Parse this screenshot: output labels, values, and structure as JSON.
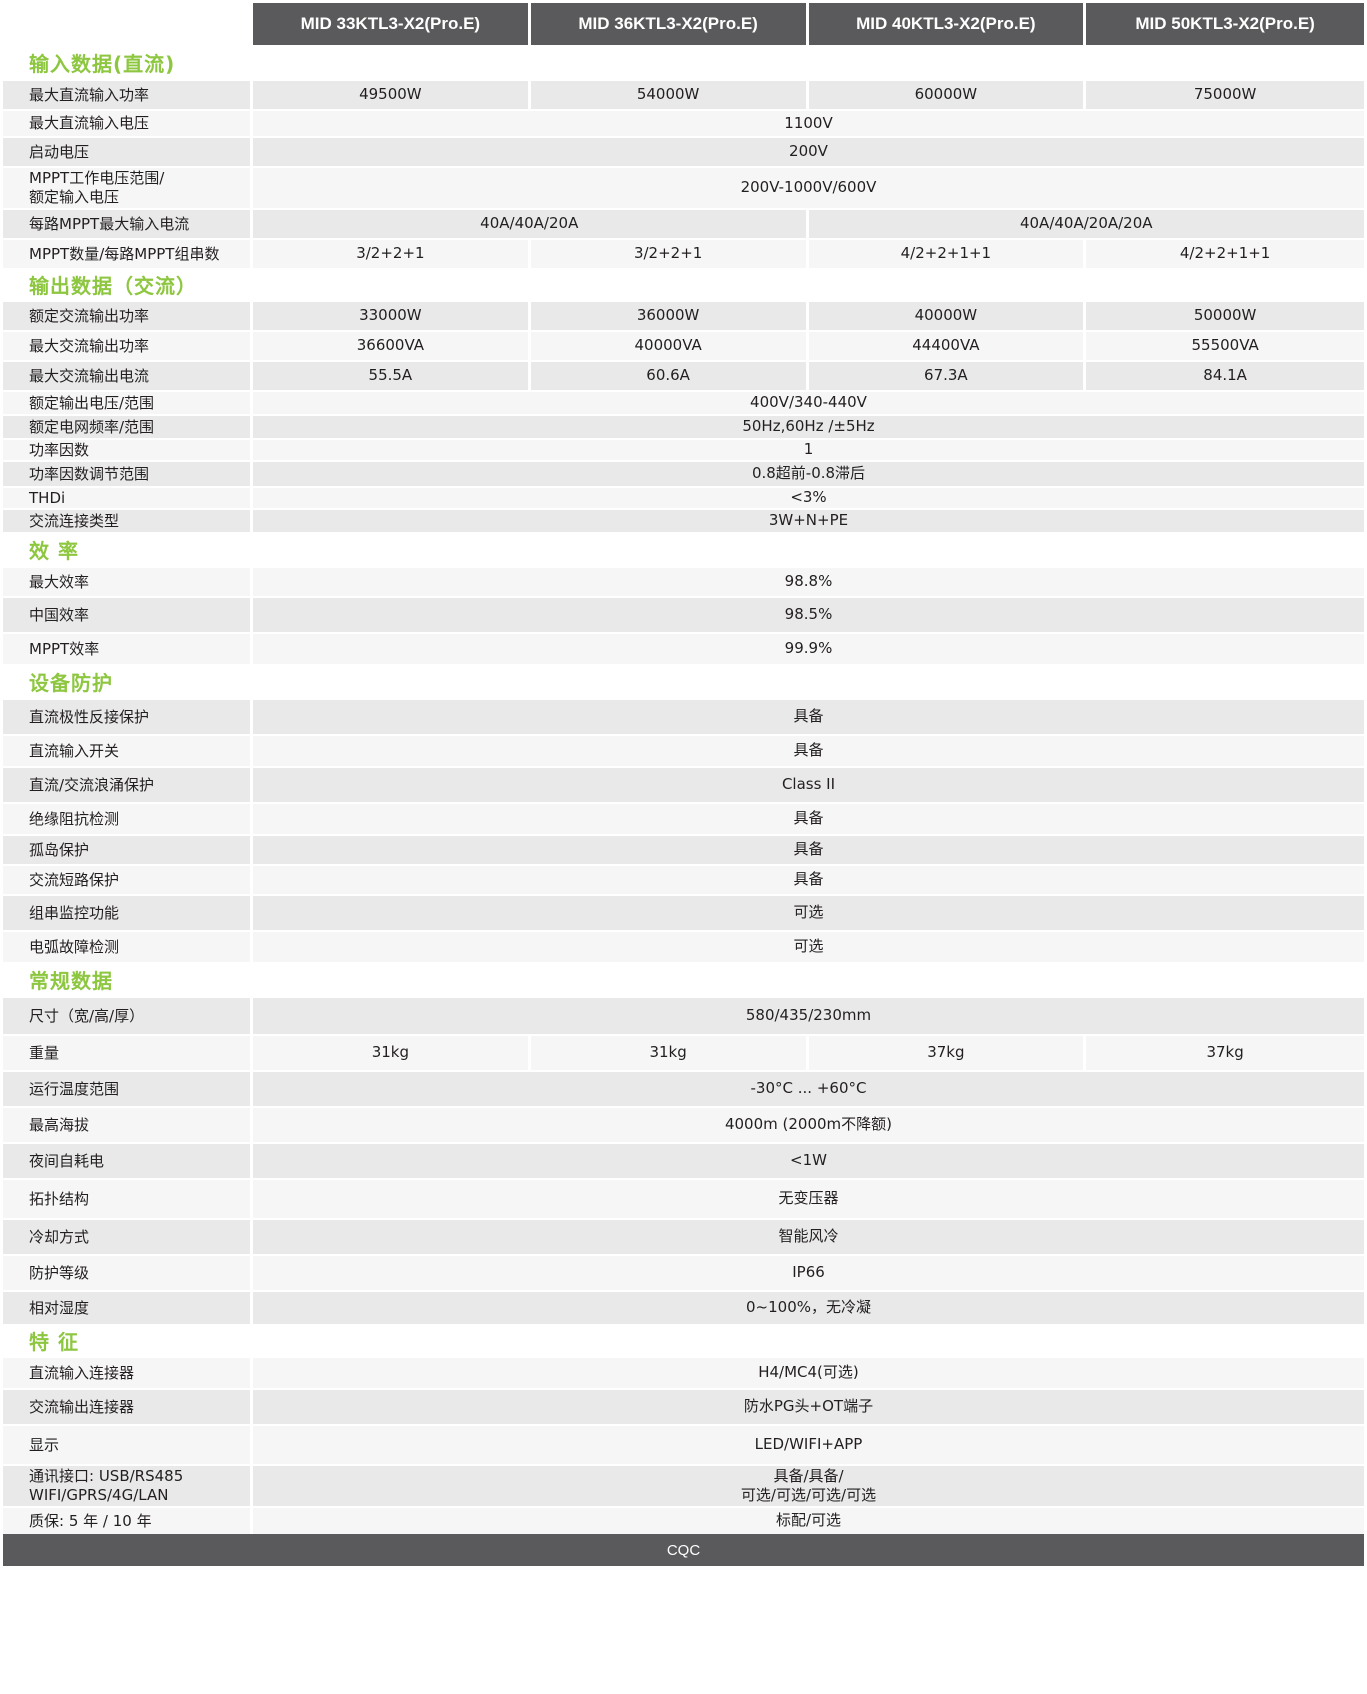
{
  "header": {
    "models": [
      "MID 33KTL3-X2(Pro.E)",
      "MID 36KTL3-X2(Pro.E)",
      "MID 40KTL3-X2(Pro.E)",
      "MID 50KTL3-X2(Pro.E)"
    ]
  },
  "sections": [
    {
      "title": "输入数据(直流)",
      "rows": [
        {
          "label": "最大直流输入功率",
          "values": [
            "49500W",
            "54000W",
            "60000W",
            "75000W"
          ],
          "spans": [
            1,
            1,
            1,
            1
          ]
        },
        {
          "label": "最大直流输入电压",
          "values": [
            "1100V"
          ],
          "spans": [
            4
          ]
        },
        {
          "label": "启动电压",
          "values": [
            "200V"
          ],
          "spans": [
            4
          ]
        },
        {
          "label": "MPPT工作电压范围/\n额定输入电压",
          "values": [
            "200V-1000V/600V"
          ],
          "spans": [
            4
          ]
        },
        {
          "label": "每路MPPT最大输入电流",
          "values": [
            "40A/40A/20A",
            "40A/40A/20A/20A"
          ],
          "spans": [
            2,
            2
          ]
        },
        {
          "label": "MPPT数量/每路MPPT组串数",
          "values": [
            "3/2+2+1",
            "3/2+2+1",
            "4/2+2+1+1",
            "4/2+2+1+1"
          ],
          "spans": [
            1,
            1,
            1,
            1
          ]
        }
      ]
    },
    {
      "title": "输出数据（交流）",
      "rows": [
        {
          "label": "额定交流输出功率",
          "values": [
            "33000W",
            "36000W",
            "40000W",
            "50000W"
          ],
          "spans": [
            1,
            1,
            1,
            1
          ]
        },
        {
          "label": "最大交流输出功率",
          "values": [
            "36600VA",
            "40000VA",
            "44400VA",
            "55500VA"
          ],
          "spans": [
            1,
            1,
            1,
            1
          ]
        },
        {
          "label": "最大交流输出电流",
          "values": [
            "55.5A",
            "60.6A",
            "67.3A",
            "84.1A"
          ],
          "spans": [
            1,
            1,
            1,
            1
          ]
        },
        {
          "label": "额定输出电压/范围",
          "values": [
            "400V/340-440V"
          ],
          "spans": [
            4
          ]
        },
        {
          "label": "额定电网频率/范围",
          "values": [
            "50Hz,60Hz /±5Hz"
          ],
          "spans": [
            4
          ]
        },
        {
          "label": "功率因数",
          "values": [
            "1"
          ],
          "spans": [
            4
          ]
        },
        {
          "label": "功率因数调节范围",
          "values": [
            "0.8超前-0.8滞后"
          ],
          "spans": [
            4
          ]
        },
        {
          "label": "THDi",
          "values": [
            "<3%"
          ],
          "spans": [
            4
          ]
        },
        {
          "label": "交流连接类型",
          "values": [
            "3W+N+PE"
          ],
          "spans": [
            4
          ]
        }
      ]
    },
    {
      "title": "效  率",
      "rows": [
        {
          "label": "最大效率",
          "values": [
            "98.8%"
          ],
          "spans": [
            4
          ]
        },
        {
          "label": "中国效率",
          "values": [
            "98.5%"
          ],
          "spans": [
            4
          ]
        },
        {
          "label": "MPPT效率",
          "values": [
            "99.9%"
          ],
          "spans": [
            4
          ]
        }
      ]
    },
    {
      "title": "设备防护",
      "rows": [
        {
          "label": "直流极性反接保护",
          "values": [
            "具备"
          ],
          "spans": [
            4
          ]
        },
        {
          "label": "直流输入开关",
          "values": [
            "具备"
          ],
          "spans": [
            4
          ]
        },
        {
          "label": "直流/交流浪涌保护",
          "values": [
            "Class II"
          ],
          "spans": [
            4
          ]
        },
        {
          "label": "绝缘阻抗检测",
          "values": [
            "具备"
          ],
          "spans": [
            4
          ]
        },
        {
          "label": "孤岛保护",
          "values": [
            "具备"
          ],
          "spans": [
            4
          ]
        },
        {
          "label": "交流短路保护",
          "values": [
            "具备"
          ],
          "spans": [
            4
          ]
        },
        {
          "label": "组串监控功能",
          "values": [
            "可选"
          ],
          "spans": [
            4
          ]
        },
        {
          "label": "电弧故障检测",
          "values": [
            "可选"
          ],
          "spans": [
            4
          ]
        }
      ]
    },
    {
      "title": "常规数据",
      "rows": [
        {
          "label": "尺寸（宽/高/厚）",
          "values": [
            "580/435/230mm"
          ],
          "spans": [
            4
          ]
        },
        {
          "label": "重量",
          "values": [
            "31kg",
            "31kg",
            "37kg",
            "37kg"
          ],
          "spans": [
            1,
            1,
            1,
            1
          ]
        },
        {
          "label": "运行温度范围",
          "values": [
            "-30°C ... +60°C"
          ],
          "spans": [
            4
          ]
        },
        {
          "label": "最高海拔",
          "values": [
            "4000m (2000m不降额)"
          ],
          "spans": [
            4
          ]
        },
        {
          "label": "夜间自耗电",
          "values": [
            "<1W"
          ],
          "spans": [
            4
          ]
        },
        {
          "label": "拓扑结构",
          "values": [
            "无变压器"
          ],
          "spans": [
            4
          ]
        },
        {
          "label": "冷却方式",
          "values": [
            "智能风冷"
          ],
          "spans": [
            4
          ]
        },
        {
          "label": "防护等级",
          "values": [
            "IP66"
          ],
          "spans": [
            4
          ]
        },
        {
          "label": "相对湿度",
          "values": [
            "0~100%，无冷凝"
          ],
          "spans": [
            4
          ]
        }
      ]
    },
    {
      "title": "特  征",
      "rows": [
        {
          "label": "直流输入连接器",
          "values": [
            "H4/MC4(可选)"
          ],
          "spans": [
            4
          ]
        },
        {
          "label": "交流输出连接器",
          "values": [
            "防水PG头+OT端子"
          ],
          "spans": [
            4
          ]
        },
        {
          "label": "显示",
          "values": [
            "LED/WIFI+APP"
          ],
          "spans": [
            4
          ]
        },
        {
          "label": "通讯接口: USB/RS485\nWIFI/GPRS/4G/LAN",
          "values": [
            "具备/具备/\n可选/可选/可选/可选"
          ],
          "spans": [
            4
          ]
        },
        {
          "label": "质保: 5 年 / 10 年",
          "values": [
            "标配/可选"
          ],
          "spans": [
            4
          ]
        }
      ]
    }
  ],
  "footer": {
    "certification": "CQC"
  }
}
